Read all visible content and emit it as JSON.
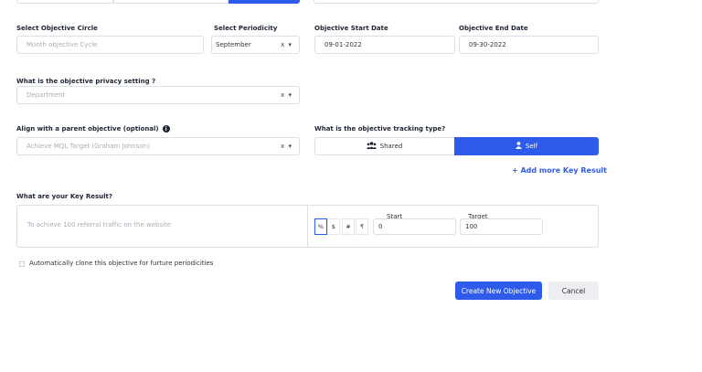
{
  "form": {
    "objective_circle": {
      "label": "Select Objective Circle",
      "placeholder": "Month objective Cycle"
    },
    "periodicity": {
      "label": "Select Periodicity",
      "value": "September",
      "clear_icon": "x",
      "caret": "▾"
    },
    "start_date": {
      "label": "Objective Start Date",
      "value": "09-01-2022"
    },
    "end_date": {
      "label": "Objective End Date",
      "value": "09-30-2022"
    },
    "privacy": {
      "label": "What is the objective privacy setting ?",
      "placeholder": "Department"
    },
    "parent": {
      "label": "Align with a parent objective (optional)",
      "placeholder": "Achieve MQL Target (Graham Johnson)"
    },
    "tracking": {
      "label": "What is the objective tracking type?",
      "options": [
        "Shared",
        "Self"
      ],
      "selected": "Self"
    },
    "add_more": "+ Add more Key Result",
    "key_result": {
      "label": "What are your Key Result?",
      "placeholder": "To achieve 100 referral traffic on the website",
      "units": [
        "%",
        "$",
        "#",
        "₹"
      ],
      "selected_unit": "%",
      "start_label": "Start",
      "start_value": "0",
      "target_label": "Target",
      "target_value": "100"
    },
    "clone_label": "Automatically clone this objective for furture periodicities",
    "create_button": "Create New Objective",
    "cancel_button": "Cancel"
  },
  "colors": {
    "primary": "#2f5bea",
    "label": "#1d2433",
    "border": "#dcdfe6"
  }
}
